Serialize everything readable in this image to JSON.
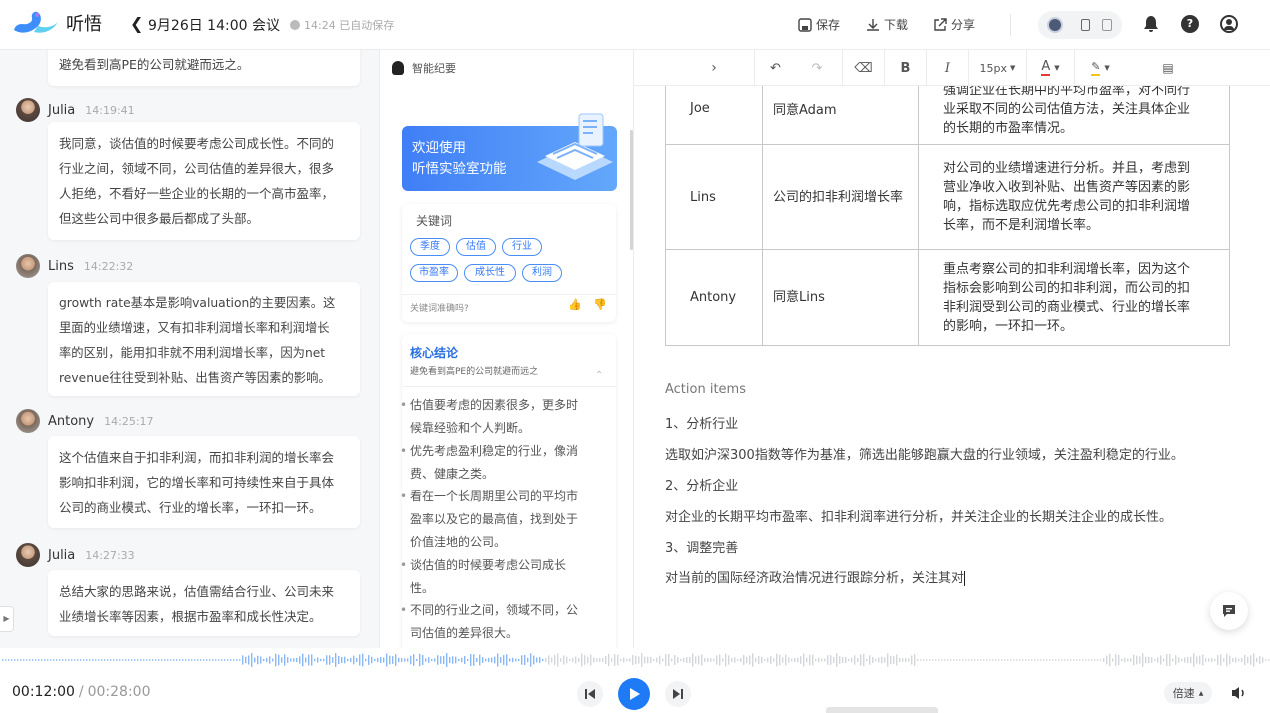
{
  "app": {
    "name": "听悟"
  },
  "header": {
    "back_icon": "chevron-left-icon",
    "title": "9月26日 14:00 会议",
    "autosave": "14:24 已自动保存",
    "save": "保存",
    "download": "下载",
    "share": "分享"
  },
  "transcript": {
    "top_fragment": "避免看到高PE的公司就避而远之。",
    "entries": [
      {
        "speaker": "Julia",
        "time": "14:19:41",
        "text": [
          "我同意，谈估值的时候要考虑公司成长性。不同的",
          "行业之间，领域不同，公司估值的差异很大，很多",
          "人拒绝，不看好一些企业的长期的一个高市盈率，",
          "但这些公司中很多最后都成了头部。"
        ]
      },
      {
        "speaker": "Lins",
        "time": "14:22:32",
        "text": [
          "growth rate基本是影响valuation的主要因素。这",
          "里面的业绩增速，又有扣非利润增长率和利润增长",
          "率的区别，能用扣非就不用利润增长率，因为net",
          "revenue往往受到补贴、出售资产等因素的影响。"
        ]
      },
      {
        "speaker": "Antony",
        "time": "14:25:17",
        "text": [
          "这个估值来自于扣非利润，而扣非利润的增长率会",
          "影响扣非利润，它的增长率和可持续性来自于具体",
          "公司的商业模式、行业的增长率，一环扣一环。"
        ]
      },
      {
        "speaker": "Julia",
        "time": "14:27:33",
        "text": [
          "总结大家的思路来说，估值需结合行业、公司未来",
          "业绩增长率等因素，根据市盈率和成长性决定。"
        ]
      }
    ]
  },
  "smart": {
    "title": "智能纪要",
    "banner": [
      "欢迎使用",
      "听悟实验室功能"
    ],
    "keywords_title": "关键词",
    "keywords": [
      "季度",
      "估值",
      "行业",
      "市盈率",
      "成长性",
      "利润"
    ],
    "feedback_question": "关键词准确吗?",
    "conclusion_title": "核心结论",
    "conclusion_sub": "避免看到高PE的公司就避而远之",
    "bullets": [
      [
        "估值要考虑的因素很多，更多时",
        "候靠经验和个人判断。"
      ],
      [
        "优先考虑盈利稳定的行业，像消",
        "费、健康之类。"
      ],
      [
        "看在一个长周期里公司的平均市",
        "盈率以及它的最高值，找到处于",
        "价值洼地的公司。"
      ],
      [
        "谈估值的时候要考虑公司成长",
        "性。"
      ],
      [
        "不同的行业之间，领域不同，公",
        "司估值的差异很大。"
      ]
    ]
  },
  "toolbar": {
    "font_size": "15px"
  },
  "doc": {
    "rows": [
      {
        "name": "Joe",
        "view": "同意Adam",
        "detail": [
          "强调企业在长期中的平均市盈率，对不同行",
          "业采取不同的公司估值方法，关注具体企业",
          "的长期的市盈率情况。"
        ]
      },
      {
        "name": "Lins",
        "view": "公司的扣非利润增长率",
        "detail": [
          "对公司的业绩增速进行分析。并且，考虑到",
          "营业净收入收到补贴、出售资产等因素的影",
          "响，指标选取应优先考虑公司的扣非利润增",
          "长率，而不是利润增长率。"
        ]
      },
      {
        "name": "Antony",
        "view": "同意Lins",
        "detail": [
          "重点考察公司的扣非利润增长率，因为这个",
          "指标会影响到公司的扣非利润，而公司的扣",
          "非利润受到公司的商业模式、行业的增长率",
          "的影响，一环扣一环。"
        ]
      }
    ],
    "action_title": "Action items",
    "items": [
      {
        "h": "1、分析行业",
        "t": "选取如沪深300指数等作为基准，筛选出能够跑赢大盘的行业领域，关注盈利稳定的行业。"
      },
      {
        "h": "2、分析企业",
        "t": "对企业的长期平均市盈率、扣非利润率进行分析，并关注企业的长期关注企业的成长性。"
      },
      {
        "h": "3、调整完善",
        "t": "对当前的国际经济政治情况进行跟踪分析，关注其对"
      }
    ]
  },
  "player": {
    "current": "00:12:00",
    "separator": "/",
    "total": "00:28:00",
    "speed": "倍速",
    "progress": 0.4286
  }
}
